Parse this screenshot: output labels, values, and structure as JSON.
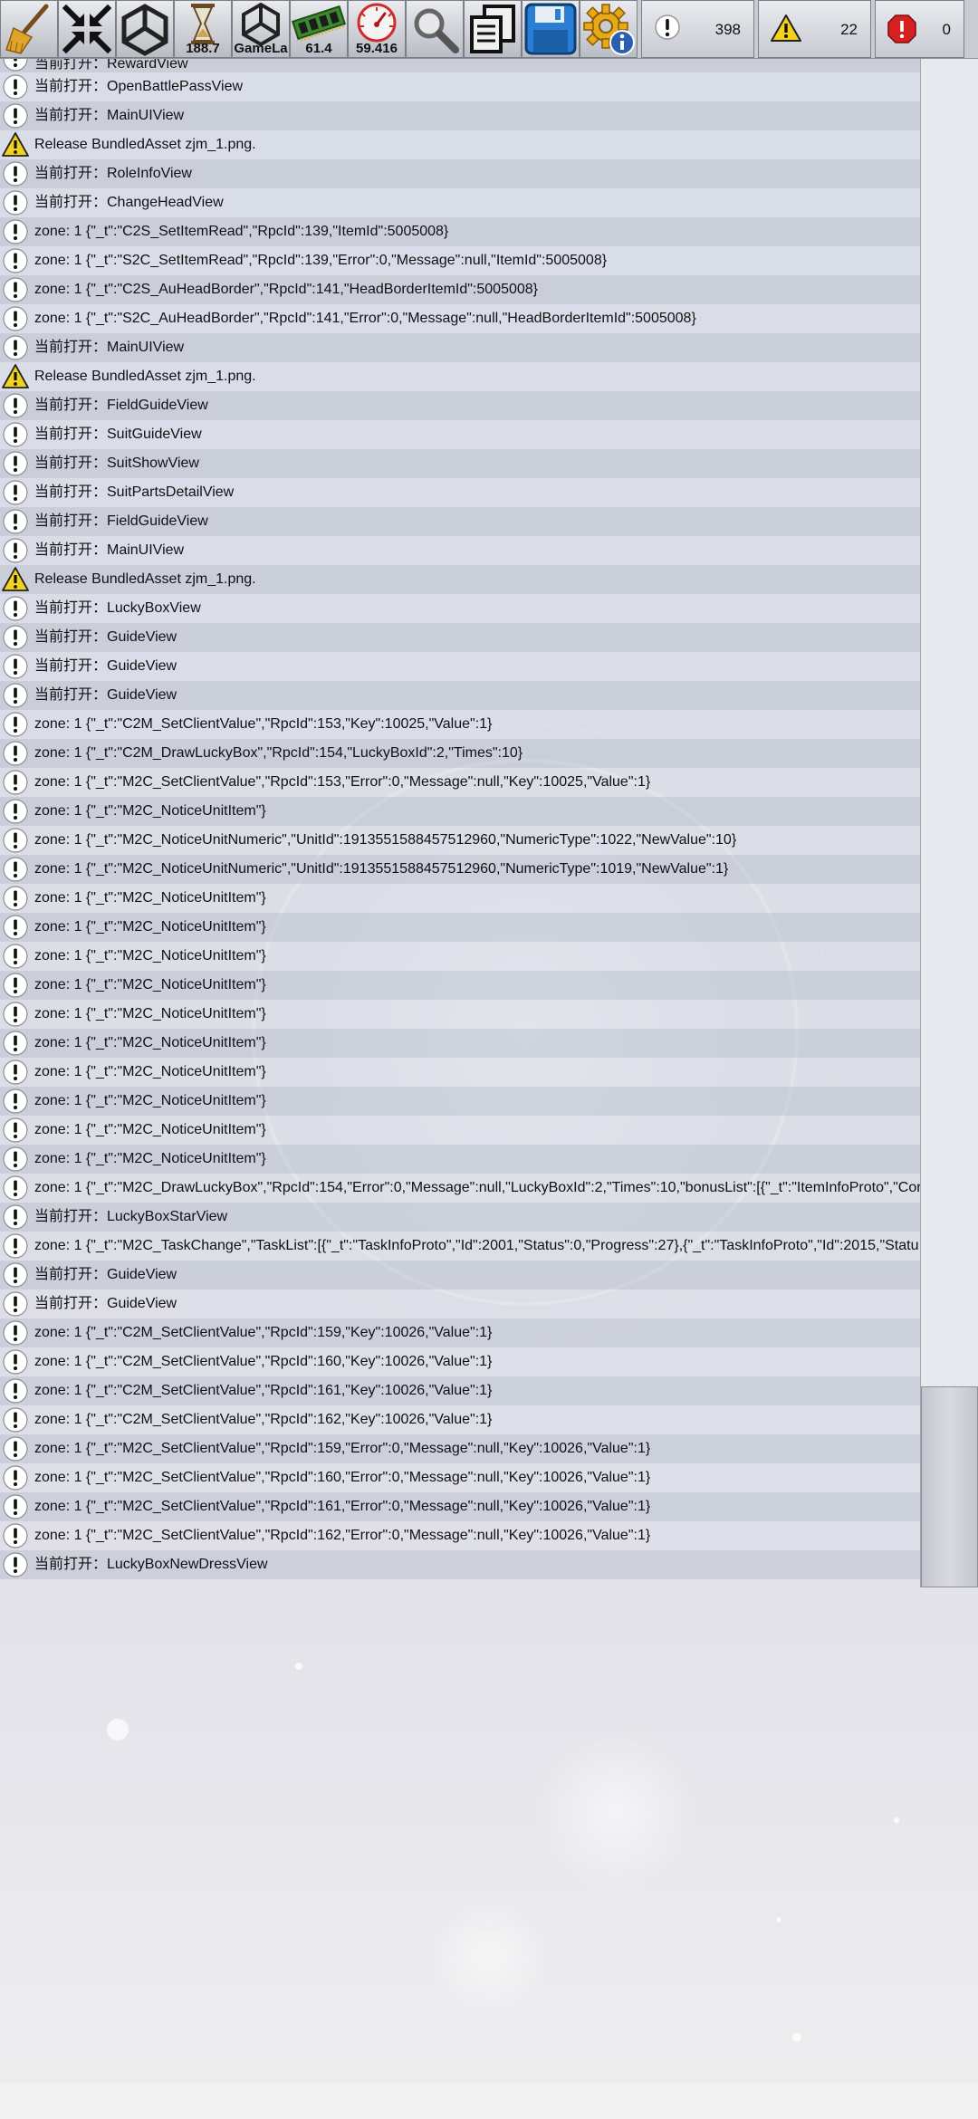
{
  "toolbar": {
    "buttons": [
      {
        "name": "clear-button",
        "icon": "broom-icon",
        "label": ""
      },
      {
        "name": "collapse-button",
        "icon": "collapse-arrows-icon",
        "label": ""
      },
      {
        "name": "unity-button",
        "icon": "unity-logo-icon",
        "label": ""
      },
      {
        "name": "time-button",
        "icon": "hourglass-icon",
        "label": "188.7"
      },
      {
        "name": "gamelayer-button",
        "icon": "unity-logo-icon",
        "label": "GameLa"
      },
      {
        "name": "memory-button",
        "icon": "ram-chip-icon",
        "label": "61.4"
      },
      {
        "name": "fps-button",
        "icon": "speedometer-icon",
        "label": "59.416"
      },
      {
        "name": "search-button",
        "icon": "search-icon",
        "label": ""
      },
      {
        "name": "copy-button",
        "icon": "copy-icon",
        "label": ""
      },
      {
        "name": "save-button",
        "icon": "floppy-disk-icon",
        "label": ""
      },
      {
        "name": "settings-button",
        "icon": "gear-info-icon",
        "label": ""
      }
    ],
    "counters": {
      "info": "398",
      "warning": "22",
      "error": "0"
    }
  },
  "colors": {
    "toolbar_bg": "#c9ccd3",
    "row_dark": "#c4c9d4",
    "row_light": "#dadee7",
    "warning_yellow": "#f2d21b",
    "error_red": "#d42020",
    "save_blue": "#2a7fd4"
  },
  "logs": [
    {
      "type": "info",
      "text": "当前打开：RewardView"
    },
    {
      "type": "info",
      "text": "当前打开：OpenBattlePassView"
    },
    {
      "type": "info",
      "text": "当前打开：MainUIView"
    },
    {
      "type": "warning",
      "text": "Release BundledAsset zjm_1.png."
    },
    {
      "type": "info",
      "text": "当前打开：RoleInfoView"
    },
    {
      "type": "info",
      "text": "当前打开：ChangeHeadView"
    },
    {
      "type": "info",
      "text": "zone: 1 {\"_t\":\"C2S_SetItemRead\",\"RpcId\":139,\"ItemId\":5005008}"
    },
    {
      "type": "info",
      "text": "zone: 1 {\"_t\":\"S2C_SetItemRead\",\"RpcId\":139,\"Error\":0,\"Message\":null,\"ItemId\":5005008}"
    },
    {
      "type": "info",
      "text": "zone: 1 {\"_t\":\"C2S_AuHeadBorder\",\"RpcId\":141,\"HeadBorderItemId\":5005008}"
    },
    {
      "type": "info",
      "text": "zone: 1 {\"_t\":\"S2C_AuHeadBorder\",\"RpcId\":141,\"Error\":0,\"Message\":null,\"HeadBorderItemId\":5005008}"
    },
    {
      "type": "info",
      "text": "当前打开：MainUIView"
    },
    {
      "type": "warning",
      "text": "Release BundledAsset zjm_1.png."
    },
    {
      "type": "info",
      "text": "当前打开：FieldGuideView"
    },
    {
      "type": "info",
      "text": "当前打开：SuitGuideView"
    },
    {
      "type": "info",
      "text": "当前打开：SuitShowView"
    },
    {
      "type": "info",
      "text": "当前打开：SuitPartsDetailView"
    },
    {
      "type": "info",
      "text": "当前打开：FieldGuideView"
    },
    {
      "type": "info",
      "text": "当前打开：MainUIView"
    },
    {
      "type": "warning",
      "text": "Release BundledAsset zjm_1.png."
    },
    {
      "type": "info",
      "text": "当前打开：LuckyBoxView"
    },
    {
      "type": "info",
      "text": "当前打开：GuideView"
    },
    {
      "type": "info",
      "text": "当前打开：GuideView"
    },
    {
      "type": "info",
      "text": "当前打开：GuideView"
    },
    {
      "type": "info",
      "text": "zone: 1 {\"_t\":\"C2M_SetClientValue\",\"RpcId\":153,\"Key\":10025,\"Value\":1}"
    },
    {
      "type": "info",
      "text": "zone: 1 {\"_t\":\"C2M_DrawLuckyBox\",\"RpcId\":154,\"LuckyBoxId\":2,\"Times\":10}"
    },
    {
      "type": "info",
      "text": "zone: 1 {\"_t\":\"M2C_SetClientValue\",\"RpcId\":153,\"Error\":0,\"Message\":null,\"Key\":10025,\"Value\":1}"
    },
    {
      "type": "info",
      "text": "zone: 1 {\"_t\":\"M2C_NoticeUnitItem\"}"
    },
    {
      "type": "info",
      "text": "zone: 1 {\"_t\":\"M2C_NoticeUnitNumeric\",\"UnitId\":1913551588457512960,\"NumericType\":1022,\"NewValue\":10}"
    },
    {
      "type": "info",
      "text": "zone: 1 {\"_t\":\"M2C_NoticeUnitNumeric\",\"UnitId\":1913551588457512960,\"NumericType\":1019,\"NewValue\":1}"
    },
    {
      "type": "info",
      "text": "zone: 1 {\"_t\":\"M2C_NoticeUnitItem\"}"
    },
    {
      "type": "info",
      "text": "zone: 1 {\"_t\":\"M2C_NoticeUnitItem\"}"
    },
    {
      "type": "info",
      "text": "zone: 1 {\"_t\":\"M2C_NoticeUnitItem\"}"
    },
    {
      "type": "info",
      "text": "zone: 1 {\"_t\":\"M2C_NoticeUnitItem\"}"
    },
    {
      "type": "info",
      "text": "zone: 1 {\"_t\":\"M2C_NoticeUnitItem\"}"
    },
    {
      "type": "info",
      "text": "zone: 1 {\"_t\":\"M2C_NoticeUnitItem\"}"
    },
    {
      "type": "info",
      "text": "zone: 1 {\"_t\":\"M2C_NoticeUnitItem\"}"
    },
    {
      "type": "info",
      "text": "zone: 1 {\"_t\":\"M2C_NoticeUnitItem\"}"
    },
    {
      "type": "info",
      "text": "zone: 1 {\"_t\":\"M2C_NoticeUnitItem\"}"
    },
    {
      "type": "info",
      "text": "zone: 1 {\"_t\":\"M2C_NoticeUnitItem\"}"
    },
    {
      "type": "info",
      "text": "zone: 1 {\"_t\":\"M2C_DrawLuckyBox\",\"RpcId\":154,\"Error\":0,\"Message\":null,\"LuckyBoxId\":2,\"Times\":10,\"bonusList\":[{\"_t\":\"ItemInfoProto\",\"Cor"
    },
    {
      "type": "info",
      "text": "当前打开：LuckyBoxStarView"
    },
    {
      "type": "info",
      "text": "zone: 1 {\"_t\":\"M2C_TaskChange\",\"TaskList\":[{\"_t\":\"TaskInfoProto\",\"Id\":2001,\"Status\":0,\"Progress\":27},{\"_t\":\"TaskInfoProto\",\"Id\":2015,\"Statu"
    },
    {
      "type": "info",
      "text": "当前打开：GuideView"
    },
    {
      "type": "info",
      "text": "当前打开：GuideView"
    },
    {
      "type": "info",
      "text": "zone: 1 {\"_t\":\"C2M_SetClientValue\",\"RpcId\":159,\"Key\":10026,\"Value\":1}"
    },
    {
      "type": "info",
      "text": "zone: 1 {\"_t\":\"C2M_SetClientValue\",\"RpcId\":160,\"Key\":10026,\"Value\":1}"
    },
    {
      "type": "info",
      "text": "zone: 1 {\"_t\":\"C2M_SetClientValue\",\"RpcId\":161,\"Key\":10026,\"Value\":1}"
    },
    {
      "type": "info",
      "text": "zone: 1 {\"_t\":\"C2M_SetClientValue\",\"RpcId\":162,\"Key\":10026,\"Value\":1}"
    },
    {
      "type": "info",
      "text": "zone: 1 {\"_t\":\"M2C_SetClientValue\",\"RpcId\":159,\"Error\":0,\"Message\":null,\"Key\":10026,\"Value\":1}"
    },
    {
      "type": "info",
      "text": "zone: 1 {\"_t\":\"M2C_SetClientValue\",\"RpcId\":160,\"Error\":0,\"Message\":null,\"Key\":10026,\"Value\":1}"
    },
    {
      "type": "info",
      "text": "zone: 1 {\"_t\":\"M2C_SetClientValue\",\"RpcId\":161,\"Error\":0,\"Message\":null,\"Key\":10026,\"Value\":1}"
    },
    {
      "type": "info",
      "text": "zone: 1 {\"_t\":\"M2C_SetClientValue\",\"RpcId\":162,\"Error\":0,\"Message\":null,\"Key\":10026,\"Value\":1}"
    },
    {
      "type": "info",
      "text": "当前打开：LuckyBoxNewDressView"
    }
  ]
}
